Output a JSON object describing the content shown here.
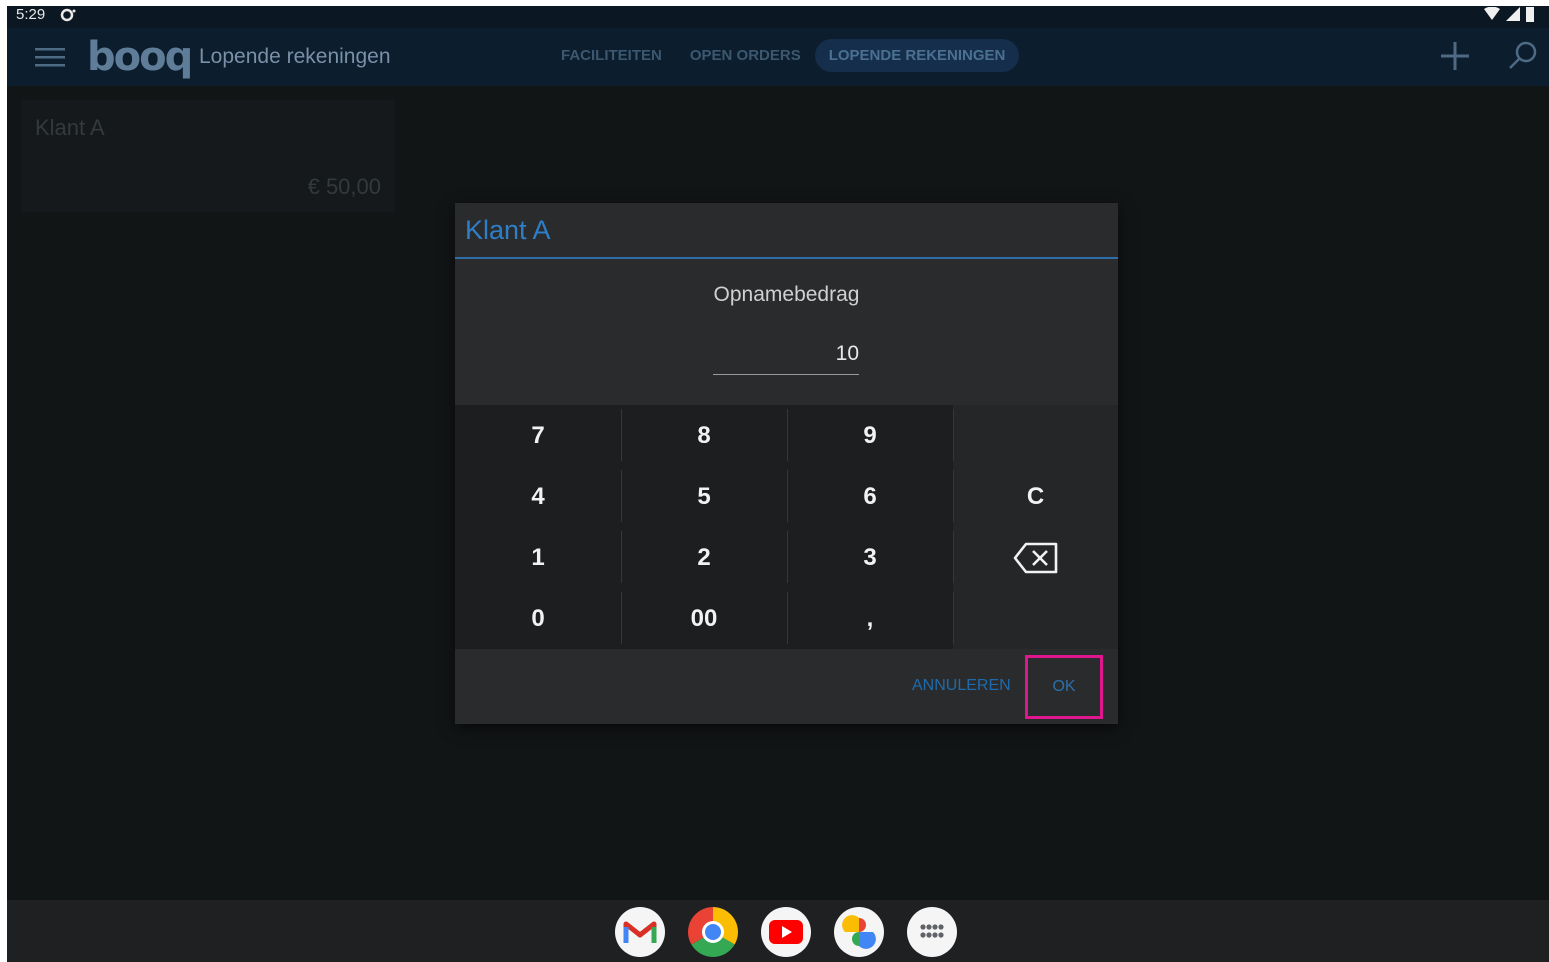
{
  "status_bar": {
    "time": "5:29"
  },
  "app_bar": {
    "logo": "booq",
    "title": "Lopende rekeningen",
    "tabs": [
      {
        "label": "FACILITEITEN",
        "active": false
      },
      {
        "label": "OPEN ORDERS",
        "active": false
      },
      {
        "label": "LOPENDE REKENINGEN",
        "active": true
      }
    ],
    "icons": [
      "menu-icon",
      "add-icon",
      "search-icon"
    ]
  },
  "accounts": [
    {
      "name": "Klant A",
      "balance": "€ 50,00"
    }
  ],
  "dialog": {
    "title": "Klant A",
    "field_label": "Opnamebedrag",
    "field_value": "10",
    "keys": {
      "k7": "7",
      "k8": "8",
      "k9": "9",
      "k4": "4",
      "k5": "5",
      "k6": "6",
      "clear": "C",
      "k1": "1",
      "k2": "2",
      "k3": "3",
      "k0": "0",
      "k00": "00",
      "comma": ","
    },
    "cancel_label": "ANNULEREN",
    "ok_label": "OK"
  },
  "dock": {
    "apps": [
      "gmail-icon",
      "chrome-icon",
      "youtube-icon",
      "photos-icon",
      "app-drawer-icon"
    ]
  },
  "colors": {
    "accent": "#2f7ec8",
    "highlight": "#e0168f",
    "app_bar": "#0c1d2d"
  }
}
